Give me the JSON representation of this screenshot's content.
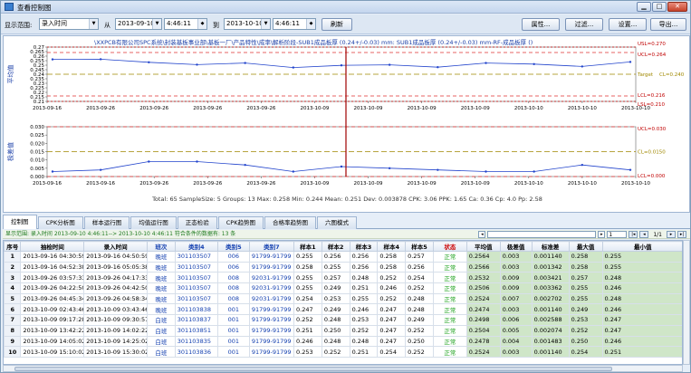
{
  "window": {
    "title": "查看控制图",
    "buttons": [
      "▁",
      "□",
      "✕"
    ]
  },
  "toolbar": {
    "range_label": "显示范围:",
    "range_value": "录入时间",
    "from_label": "从",
    "from_date": "2013-09-10",
    "from_time": "4:46:11",
    "to_label": "到",
    "to_date": "2013-10-10",
    "to_time": "4:46:11",
    "refresh": "刷新",
    "attr": "属性...",
    "filter": "过滤...",
    "settings": "设置...",
    "export": "导出..."
  },
  "chart": {
    "title": "\\XXPCB有限公司SPC系统\\封装基板事业部\\基板一厂\\产品特性\\成率\\解析阶段-SUB1成品板厚 (0.24+/-0.03) mm: SUB1成品板厚 (0.24+/-0.03) mm-RF-成品板厚    ()",
    "xbar_ylabel": "平均值",
    "range_ylabel": "极差值",
    "xbar_ticks": [
      "0.27",
      "0.265",
      "0.26",
      "0.255",
      "0.25",
      "0.245",
      "0.24",
      "0.235",
      "0.23",
      "0.225",
      "0.22",
      "0.215",
      "0.21"
    ],
    "range_ticks": [
      "0.030",
      "0.025",
      "0.020",
      "0.015",
      "0.010",
      "0.005",
      "0.000"
    ],
    "xbar_dates": [
      "2013-09-16",
      "2013-09-26",
      "2013-09-26",
      "2013-09-26",
      "2013-09-26",
      "2013-10-09",
      "2013-10-09",
      "2013-10-09",
      "2013-10-09",
      "2013-10-10",
      "2013-10-10",
      "2013-10-10"
    ],
    "range_dates": [
      "2013-09-16",
      "2013-09-16",
      "2013-09-26",
      "2013-09-26",
      "2013-09-26",
      "2013-10-09",
      "2013-10-09",
      "2013-10-09",
      "2013-10-09",
      "2013-10-10",
      "2013-10-10",
      "2013-10-10"
    ],
    "xbar_limits": {
      "usl": "USL=0.270",
      "ucl": "UCL=0.264",
      "target": "Target",
      "cl": "CL=0.240",
      "lcl": "LCL=0.216",
      "lsl": "LSL=0.210"
    },
    "range_limits": {
      "ucl": "UCL=0.030",
      "cl": "CL=0.0150",
      "lcl": "LCL=0.000"
    },
    "stats": "Total: 65   SampleSize: 5   Groups: 13   Max: 0.258   Min: 0.244   Mean: 0.251   Dev: 0.003878   CPK: 3.06   PPK: 1.65   Ca: 0.36   Cp: 4.0   Pp: 2.58"
  },
  "chart_data": [
    {
      "type": "line",
      "title": "平均值",
      "ylim": [
        0.21,
        0.27
      ],
      "x": [
        1,
        2,
        3,
        4,
        5,
        6,
        7,
        8,
        9,
        10,
        11,
        12,
        13
      ],
      "series": [
        {
          "values": [
            0.2564,
            0.2566,
            0.2532,
            0.2506,
            0.2524,
            0.2474,
            0.2498,
            0.2504,
            0.2478,
            0.2524,
            0.2512,
            0.2486,
            0.2536
          ]
        }
      ],
      "limits": {
        "USL": 0.27,
        "UCL": 0.264,
        "CL": 0.24,
        "LCL": 0.216,
        "LSL": 0.21
      }
    },
    {
      "type": "line",
      "title": "极差值",
      "ylim": [
        0,
        0.03
      ],
      "x": [
        1,
        2,
        3,
        4,
        5,
        6,
        7,
        8,
        9,
        10,
        11,
        12,
        13
      ],
      "series": [
        {
          "values": [
            0.003,
            0.004,
            0.009,
            0.009,
            0.007,
            0.003,
            0.006,
            0.005,
            0.004,
            0.003,
            0.003,
            0.007,
            0.004
          ]
        }
      ],
      "limits": {
        "UCL": 0.03,
        "CL": 0.015,
        "LCL": 0.0
      }
    }
  ],
  "tabs": [
    "控制图",
    "CPK分析图",
    "样本运行图",
    "均值运行图",
    "正态检验",
    "CPK趋势图",
    "合格率趋势图",
    "六图模式"
  ],
  "infobar": "显示范围: 录入时间 2013-09-10 4:46:11--> 2013-10-10 4:46:11 符合条件的数据有: 13 条",
  "pager": {
    "page": "1",
    "total": "1/1"
  },
  "table": {
    "headers": [
      "序号",
      "抽检时间",
      "录入时间",
      "班次",
      "类别4",
      "类别5",
      "类别7",
      "样本1",
      "样本2",
      "样本3",
      "样本4",
      "样本5",
      "状态",
      "平均值",
      "极差值",
      "标准差",
      "最大值",
      "最小值"
    ],
    "rows": [
      [
        "1",
        "2013-09-16 04:30:59",
        "2013-09-16 04:50:59",
        "晚班",
        "301103507",
        "006",
        "91799-91799",
        "0.255",
        "0.256",
        "0.256",
        "0.258",
        "0.257",
        "正常",
        "0.2564",
        "0.003",
        "0.001140",
        "0.258",
        "0.255"
      ],
      [
        "2",
        "2013-09-16 04:52:38",
        "2013-09-16 05:05:38",
        "晚班",
        "301103507",
        "006",
        "91799-91799",
        "0.258",
        "0.255",
        "0.256",
        "0.258",
        "0.256",
        "正常",
        "0.2566",
        "0.003",
        "0.001342",
        "0.258",
        "0.255"
      ],
      [
        "3",
        "2013-09-26 03:57:33",
        "2013-09-26 04:17:33",
        "晚班",
        "301103507",
        "008",
        "92031-91799",
        "0.255",
        "0.257",
        "0.248",
        "0.252",
        "0.254",
        "正常",
        "0.2532",
        "0.009",
        "0.003421",
        "0.257",
        "0.248"
      ],
      [
        "4",
        "2013-09-26 04:22:50",
        "2013-09-26 04:42:50",
        "晚班",
        "301103507",
        "008",
        "92031-91799",
        "0.255",
        "0.249",
        "0.251",
        "0.246",
        "0.252",
        "正常",
        "0.2506",
        "0.009",
        "0.003362",
        "0.255",
        "0.246"
      ],
      [
        "5",
        "2013-09-26 04:45:34",
        "2013-09-26 04:58:34",
        "晚班",
        "301103507",
        "008",
        "92031-91799",
        "0.254",
        "0.253",
        "0.255",
        "0.252",
        "0.248",
        "正常",
        "0.2524",
        "0.007",
        "0.002702",
        "0.255",
        "0.248"
      ],
      [
        "6",
        "2013-10-09 02:43:46",
        "2013-10-09 03:43:46",
        "晚班",
        "301103838",
        "001",
        "91799-91799",
        "0.247",
        "0.249",
        "0.246",
        "0.247",
        "0.248",
        "正常",
        "0.2474",
        "0.003",
        "0.001140",
        "0.249",
        "0.246"
      ],
      [
        "7",
        "2013-10-09 09:17:28",
        "2013-10-09 09:30:57",
        "白班",
        "301103837",
        "001",
        "91799-91799",
        "0.252",
        "0.248",
        "0.253",
        "0.247",
        "0.249",
        "正常",
        "0.2498",
        "0.006",
        "0.002588",
        "0.253",
        "0.247"
      ],
      [
        "8",
        "2013-10-09 13:42:22",
        "2013-10-09 14:02:22",
        "白班",
        "301103851",
        "001",
        "91799-91799",
        "0.251",
        "0.250",
        "0.252",
        "0.247",
        "0.252",
        "正常",
        "0.2504",
        "0.005",
        "0.002074",
        "0.252",
        "0.247"
      ],
      [
        "9",
        "2013-10-09 14:05:02",
        "2013-10-09 14:25:02",
        "白班",
        "301103835",
        "001",
        "91799-91799",
        "0.246",
        "0.248",
        "0.248",
        "0.247",
        "0.250",
        "正常",
        "0.2478",
        "0.004",
        "0.001483",
        "0.250",
        "0.246"
      ],
      [
        "10",
        "2013-10-09 15:10:02",
        "2013-10-09 15:30:02",
        "白班",
        "301103836",
        "001",
        "91799-91799",
        "0.253",
        "0.252",
        "0.251",
        "0.254",
        "0.252",
        "正常",
        "0.2524",
        "0.003",
        "0.001140",
        "0.254",
        "0.251"
      ]
    ]
  },
  "colors": {
    "spec": "#c00000",
    "control": "#e03030",
    "target": "#a08800",
    "line": "#2244cc",
    "cursor": "#a00000",
    "status": "#19a019"
  }
}
